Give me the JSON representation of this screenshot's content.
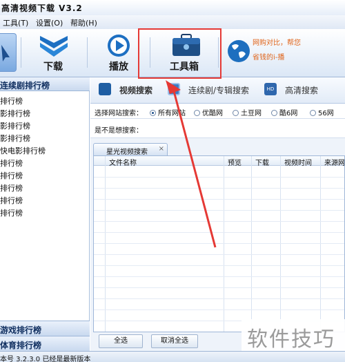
{
  "window": {
    "title": "高清视频下载 V3.2"
  },
  "menu": [
    {
      "label": "工具(T)"
    },
    {
      "label": "设置(O)"
    },
    {
      "label": "帮助(H)"
    }
  ],
  "toolbar": {
    "download_label": "下载",
    "play_label": "播放",
    "tools_label": "工具箱",
    "promo_line1": "网购对比，帮您",
    "promo_line2": "省钱的i-播"
  },
  "sidebar": {
    "header": "连续剧排行榜",
    "items": [
      "排行榜",
      "影排行榜",
      "影排行榜",
      "影排行榜",
      "快电影排行榜",
      "排行榜",
      "排行榜",
      "排行榜",
      "排行榜",
      "排行榜"
    ],
    "footer1": "游戏排行榜",
    "footer2": "体育排行榜"
  },
  "tabs": {
    "video_search": "视频搜索",
    "series_search": "连续剧/专辑搜索",
    "hd_search": "高清搜索"
  },
  "filter": {
    "label": "选择网站搜索：",
    "options": [
      {
        "label": "所有网站",
        "selected": true
      },
      {
        "label": "优酷网",
        "selected": false
      },
      {
        "label": "土豆网",
        "selected": false
      },
      {
        "label": "酷6网",
        "selected": false
      },
      {
        "label": "56网",
        "selected": false
      }
    ]
  },
  "guess": {
    "label": "是不是想搜索："
  },
  "results": {
    "tab_label": "星光视频搜索",
    "tab_close": "×",
    "columns": [
      "文件名称",
      "预览",
      "下载",
      "视频时间",
      "来源网"
    ]
  },
  "buttons": {
    "select_all": "全选",
    "deselect_all": "取消全选"
  },
  "status": {
    "text": "本号 3.2.3.0  已经是最新版本"
  },
  "watermark": {
    "text": "软件技巧"
  },
  "colors": {
    "accent": "#1f5fa8",
    "annotation": "#e53935",
    "promo": "#e0641a"
  }
}
